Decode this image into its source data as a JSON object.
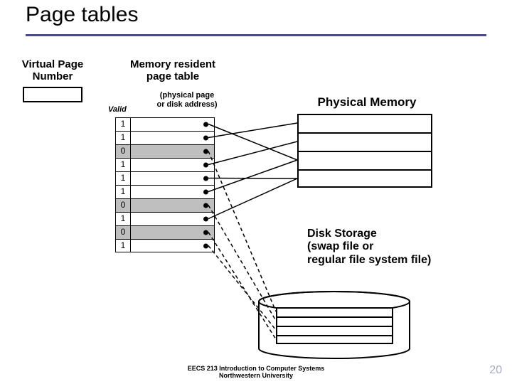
{
  "title": "Page tables",
  "labels": {
    "vpn": "Virtual Page\nNumber",
    "mrpt": "Memory resident\npage table",
    "valid": "Valid",
    "addr_note": "(physical page\nor disk address)",
    "pm": "Physical Memory",
    "ds": "Disk Storage\n(swap file or\nregular file system file)"
  },
  "page_table": [
    {
      "valid": "1",
      "shaded": false
    },
    {
      "valid": "1",
      "shaded": false
    },
    {
      "valid": "0",
      "shaded": true
    },
    {
      "valid": "1",
      "shaded": false
    },
    {
      "valid": "1",
      "shaded": false
    },
    {
      "valid": "1",
      "shaded": false
    },
    {
      "valid": "0",
      "shaded": true
    },
    {
      "valid": "1",
      "shaded": false
    },
    {
      "valid": "0",
      "shaded": true
    },
    {
      "valid": "1",
      "shaded": false
    }
  ],
  "phys_mem_slots": 4,
  "disk_slots": 4,
  "footer": {
    "line1": "EECS 213 Introduction to Computer Systems",
    "line2": "Northwestern University"
  },
  "page_number": "20",
  "colors": {
    "title_rule": "#4a4a8a",
    "shaded": "#bfbfbf",
    "pagenum": "#a8a8c8"
  }
}
